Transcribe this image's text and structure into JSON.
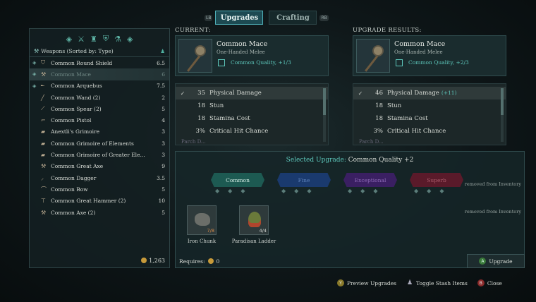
{
  "tabs": {
    "lb": "LB",
    "upgrades": "Upgrades",
    "crafting": "Crafting",
    "rb": "RB"
  },
  "weapons_panel": {
    "header": "Weapons",
    "sort": "(Sorted by: Type)",
    "items": [
      {
        "name": "Common Round Shield",
        "value": "6.5",
        "icon": "shield-icon",
        "selected": false
      },
      {
        "name": "Common Mace",
        "value": "6",
        "icon": "mace-icon",
        "selected": true
      },
      {
        "name": "Common Arquebus",
        "value": "7.5",
        "icon": "arquebus-icon",
        "selected": false
      },
      {
        "name": "Common Wand (2)",
        "value": "2",
        "icon": "wand-icon",
        "selected": false
      },
      {
        "name": "Common Spear (2)",
        "value": "5",
        "icon": "spear-icon",
        "selected": false
      },
      {
        "name": "Common Pistol",
        "value": "4",
        "icon": "pistol-icon",
        "selected": false
      },
      {
        "name": "Anextli's Grimoire",
        "value": "3",
        "icon": "grimoire-icon",
        "selected": false
      },
      {
        "name": "Common Grimoire of Elements",
        "value": "3",
        "icon": "grimoire-icon",
        "selected": false
      },
      {
        "name": "Common Grimoire of Greater Ele...",
        "value": "3",
        "icon": "grimoire-icon",
        "selected": false
      },
      {
        "name": "Common Great Axe",
        "value": "9",
        "icon": "great-axe-icon",
        "selected": false
      },
      {
        "name": "Common Dagger",
        "value": "3.5",
        "icon": "dagger-icon",
        "selected": false
      },
      {
        "name": "Common Bow",
        "value": "5",
        "icon": "bow-icon",
        "selected": false
      },
      {
        "name": "Common Great Hammer (2)",
        "value": "10",
        "icon": "hammer-icon",
        "selected": false
      },
      {
        "name": "Common Axe (2)",
        "value": "5",
        "icon": "axe-icon",
        "selected": false
      }
    ],
    "gold": "1,263"
  },
  "current": {
    "title": "CURRENT:",
    "name": "Common Mace",
    "type": "One-Handed Melee",
    "quality": "Common Quality, +1/3",
    "stats": [
      {
        "value": "35",
        "label": "Physical Damage",
        "delta": ""
      },
      {
        "value": "18",
        "label": "Stun",
        "delta": ""
      },
      {
        "value": "18",
        "label": "Stamina Cost",
        "delta": ""
      },
      {
        "value": "3%",
        "label": "Critical Hit Chance",
        "delta": ""
      }
    ],
    "cutoff": "Parch D..."
  },
  "result": {
    "title": "UPGRADE RESULTS:",
    "name": "Common Mace",
    "type": "One-Handed Melee",
    "quality": "Common Quality, +2/3",
    "stats": [
      {
        "value": "46",
        "label": "Physical Damage",
        "delta": "(+11)"
      },
      {
        "value": "18",
        "label": "Stun",
        "delta": ""
      },
      {
        "value": "18",
        "label": "Stamina Cost",
        "delta": ""
      },
      {
        "value": "3%",
        "label": "Critical Hit Chance",
        "delta": ""
      }
    ],
    "cutoff": "Parch D..."
  },
  "selected_upgrade": {
    "label": "Selected Upgrade:",
    "value": "Common Quality +2",
    "tiers": [
      "Common",
      "Fine",
      "Exceptional",
      "Superb"
    ],
    "removed_1": "removed from Inventory",
    "removed_2": "removed from Inventory",
    "materials": [
      {
        "name": "Iron Chunk",
        "count": "7/8"
      },
      {
        "name": "Paradisan Ladder",
        "count": "4/4"
      }
    ]
  },
  "requires": {
    "label": "Requires:",
    "value": "0"
  },
  "upgrade_button": {
    "key": "A",
    "label": "Upgrade"
  },
  "footer": {
    "preview_key": "Y",
    "preview": "Preview Upgrades",
    "stash": "Toggle Stash Items",
    "close_key": "B",
    "close": "Close"
  }
}
